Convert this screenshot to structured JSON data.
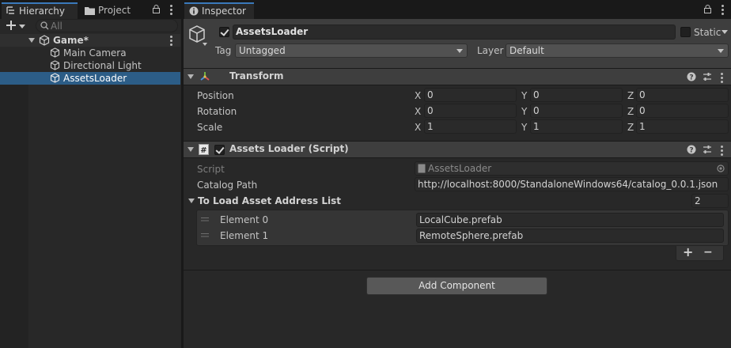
{
  "hierarchy": {
    "tab_label": "Hierarchy",
    "project_tab_label": "Project",
    "search_placeholder": "All",
    "scene_name": "Game*",
    "items": [
      {
        "label": "Main Camera"
      },
      {
        "label": "Directional Light"
      },
      {
        "label": "AssetsLoader"
      }
    ],
    "selected_index": 2
  },
  "inspector": {
    "tab_label": "Inspector",
    "object_name": "AssetsLoader",
    "static_label": "Static",
    "tag_label": "Tag",
    "tag_value": "Untagged",
    "layer_label": "Layer",
    "layer_value": "Default",
    "transform": {
      "title": "Transform",
      "rows": [
        {
          "label": "Position",
          "x": "0",
          "y": "0",
          "z": "0"
        },
        {
          "label": "Rotation",
          "x": "0",
          "y": "0",
          "z": "0"
        },
        {
          "label": "Scale",
          "x": "1",
          "y": "1",
          "z": "1"
        }
      ],
      "axis_x": "X",
      "axis_y": "Y",
      "axis_z": "Z"
    },
    "script_component": {
      "title": "Assets Loader (Script)",
      "script_label": "Script",
      "script_value": "AssetsLoader",
      "catalog_label": "Catalog Path",
      "catalog_value": "http://localhost:8000/StandaloneWindows64/catalog_0.0.1.json",
      "list_label": "To Load Asset Address List",
      "list_count": "2",
      "elements": [
        {
          "label": "Element 0",
          "value": "LocalCube.prefab"
        },
        {
          "label": "Element 1",
          "value": "RemoteSphere.prefab"
        }
      ],
      "add_symbol": "+",
      "remove_symbol": "−"
    },
    "add_component_label": "Add Component"
  },
  "colors": {
    "accent": "#3a79bb",
    "selection": "#2c5d87",
    "panel": "#282828",
    "header": "#3e3e3e"
  }
}
